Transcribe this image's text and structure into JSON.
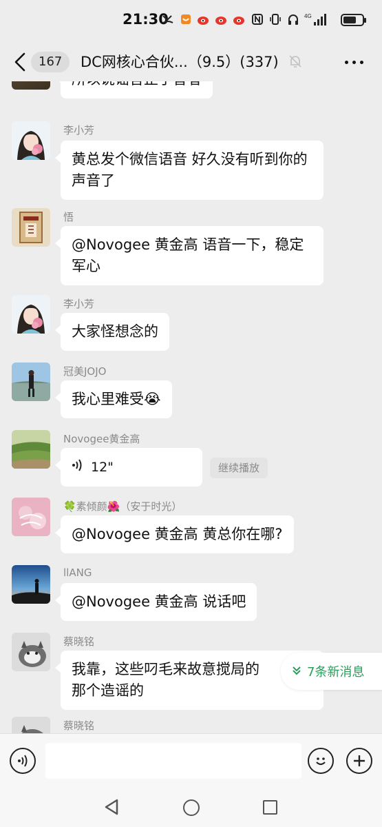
{
  "status_bar": {
    "time": "21:30",
    "network": "4G"
  },
  "header": {
    "unread_count": "167",
    "title": "DC网核心合伙...（9.5）(337)"
  },
  "messages": [
    {
      "sender": "",
      "text": "所以说谣言止于智者"
    },
    {
      "sender": "李小芳",
      "text": "黄总发个微信语音 好久没有听到你的声音了"
    },
    {
      "sender": "悟",
      "text": "@Novogee 黄金高  语音一下，稳定军心"
    },
    {
      "sender": "李小芳",
      "text": "大家怪想念的"
    },
    {
      "sender": "冠美JOJO",
      "text": "我心里难受😭"
    },
    {
      "sender": "Novogee黄金高",
      "voice_duration": "12\"",
      "continue_label": "继续播放"
    },
    {
      "sender": "🍀素倾颜🌺（安于时光）",
      "text": "@Novogee 黄金高  黄总你在哪?"
    },
    {
      "sender": "llANG",
      "text": "@Novogee 黄金高  说话吧"
    },
    {
      "sender": "蔡晓铭",
      "text": "我靠，这些叼毛来故意搅局的\n那个造谣的"
    },
    {
      "sender": "蔡晓铭",
      "text": ""
    }
  ],
  "new_messages_label": "7条新消息",
  "colors": {
    "background": "#ededed",
    "bubble": "#ffffff",
    "new_msg_accent": "#2a9d5a"
  }
}
